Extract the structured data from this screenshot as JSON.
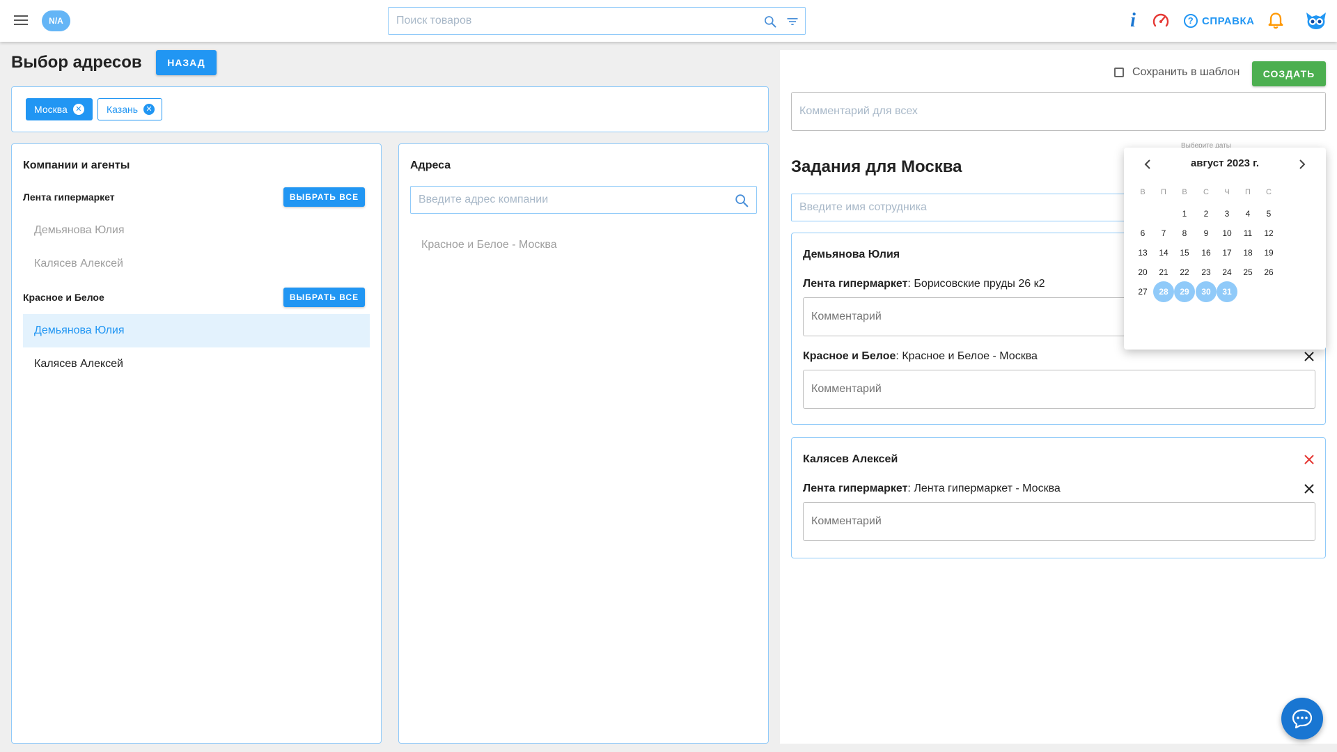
{
  "header": {
    "badge": "N/A",
    "search_placeholder": "Поиск товаров",
    "help_label": "СПРАВКА"
  },
  "page": {
    "title": "Выбор адресов",
    "back_label": "НАЗАД"
  },
  "chips": [
    {
      "label": "Москва",
      "active": true
    },
    {
      "label": "Казань",
      "active": false
    }
  ],
  "companies": {
    "title": "Компании и агенты",
    "select_all_label": "ВЫБРАТЬ ВСЕ",
    "groups": [
      {
        "name": "Лента гипермаркет",
        "agents": [
          "Демьянова Юлия",
          "Калясев Алексей"
        ]
      },
      {
        "name": "Красное и Белое",
        "agents": [
          "Демьянова Юлия",
          "Калясев Алексей"
        ]
      }
    ]
  },
  "addresses": {
    "title": "Адреса",
    "search_placeholder": "Введите адрес компании",
    "items": [
      "Красное и Белое - Москва"
    ]
  },
  "right": {
    "save_template_label": "Сохранить в шаблон",
    "create_label": "СОЗДАТЬ",
    "comment_all_placeholder": "Комментарий для всех",
    "tasks_title": "Задания для Москва",
    "employee_placeholder": "Введите имя сотрудника",
    "comment_placeholder": "Комментарий",
    "employees": [
      {
        "name": "Демьянова Юлия",
        "tasks": [
          {
            "company": "Лента гипермаркет",
            "address": ": Борисовские пруды 26 к2"
          },
          {
            "company": "Красное и Белое",
            "address": ": Красное и Белое - Москва"
          }
        ]
      },
      {
        "name": "Калясев Алексей",
        "tasks": [
          {
            "company": "Лента гипермаркет",
            "address": ": Лента гипермаркет - Москва"
          }
        ]
      }
    ]
  },
  "datepicker": {
    "hint": "Выберите даты",
    "month": "август 2023 г.",
    "weekdays": [
      "В",
      "П",
      "В",
      "С",
      "Ч",
      "П",
      "С"
    ],
    "weeks": [
      [
        "",
        "",
        "1",
        "2",
        "3",
        "4",
        "5"
      ],
      [
        "6",
        "7",
        "8",
        "9",
        "10",
        "11",
        "12"
      ],
      [
        "13",
        "14",
        "15",
        "16",
        "17",
        "18",
        "19"
      ],
      [
        "20",
        "21",
        "22",
        "23",
        "24",
        "25",
        "26"
      ],
      [
        "27",
        "28",
        "29",
        "30",
        "31",
        "",
        ""
      ]
    ],
    "selected_days": [
      "28",
      "29",
      "30",
      "31"
    ]
  },
  "icons": {
    "menu": "menu-icon",
    "search": "search-icon",
    "filter": "filter-icon",
    "info": "info-icon",
    "speedometer": "speedometer-icon",
    "help": "help-circle-icon",
    "bell": "bell-icon",
    "logo": "owl-logo-icon",
    "chat": "chat-icon"
  },
  "colors": {
    "primary": "#2196f3",
    "success": "#4caf50",
    "danger": "#e53935",
    "bell": "#ff9800"
  }
}
